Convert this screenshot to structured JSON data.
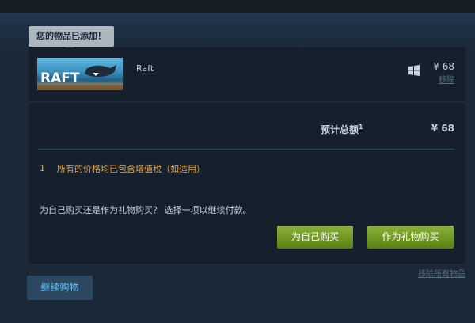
{
  "notification": {
    "added_text": "您的物品已添加！"
  },
  "cart_item": {
    "game_name": "Raft",
    "capsule_text": "RAFT",
    "platform_icon": "windows-icon",
    "price": "¥ 68",
    "remove_label": "移除"
  },
  "summary": {
    "total_label": "预计总额",
    "total_footnote": "1",
    "total_price": "¥ 68",
    "note_number": "1",
    "note_text": "所有的价格均已包含增值税（如适用）"
  },
  "purchase": {
    "question": "为自己购买还是作为礼物购买？ 选择一项以继续付款。",
    "self_button": "为自己购买",
    "gift_button": "作为礼物购买"
  },
  "footer": {
    "remove_all": "移除所有物品",
    "continue_button": "继续购物"
  },
  "colors": {
    "background": "#1b2838",
    "panel": "#16202d",
    "accent_green": "#8ab33a",
    "note_orange": "#e0a545",
    "link_blue": "#67c1f5"
  }
}
